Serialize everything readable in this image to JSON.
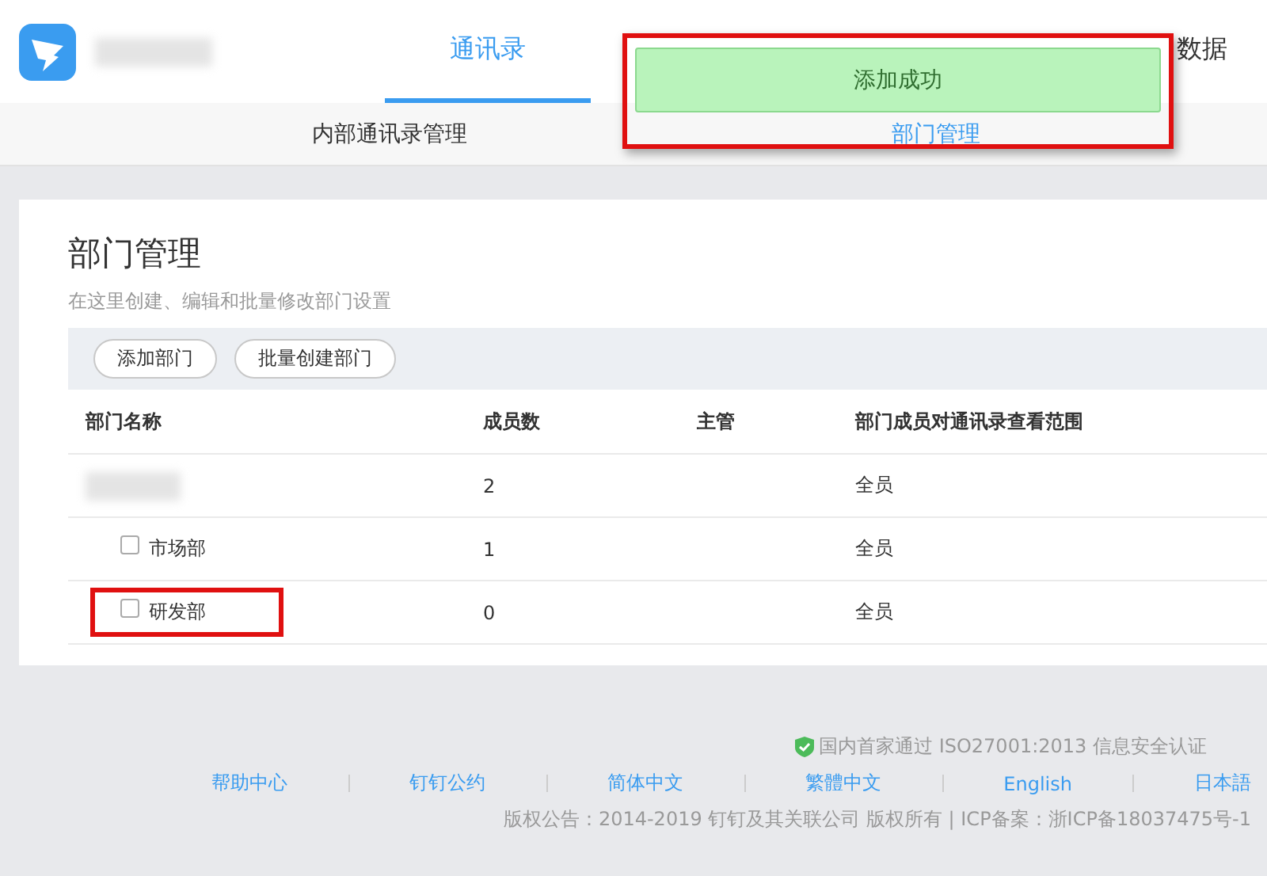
{
  "top_nav": {
    "tabs": [
      {
        "label": "通讯录",
        "selected": true
      },
      {
        "label": "数据",
        "selected": false
      }
    ]
  },
  "sub_nav": {
    "tabs": [
      {
        "label": "内部通讯录管理",
        "selected": false
      },
      {
        "label": "部门管理",
        "selected": true
      }
    ]
  },
  "toast": {
    "message": "添加成功"
  },
  "panel": {
    "title": "部门管理",
    "subtitle": "在这里创建、编辑和批量修改部门设置",
    "buttons": [
      "添加部门",
      "批量创建部门"
    ],
    "columns": [
      "部门名称",
      "成员数",
      "主管",
      "部门成员对通讯录查看范围"
    ],
    "rows": [
      {
        "kind": "redacted",
        "members": "2",
        "scope": "全员"
      },
      {
        "kind": "sub",
        "name": "市场部",
        "checked": false,
        "members": "1",
        "scope": "全员",
        "highlighted": false
      },
      {
        "kind": "sub",
        "name": "研发部",
        "checked": false,
        "members": "0",
        "scope": "全员",
        "highlighted": true
      }
    ]
  },
  "footer": {
    "certification": "国内首家通过 ISO27001:2013 信息安全认证",
    "links": [
      "帮助中心",
      "钉钉公约",
      "简体中文",
      "繁體中文",
      "English",
      "日本語"
    ],
    "copyright": "版权公告：2014-2019 钉钉及其关联公司 版权所有 | ICP备案：浙ICP备18037475号-1"
  }
}
